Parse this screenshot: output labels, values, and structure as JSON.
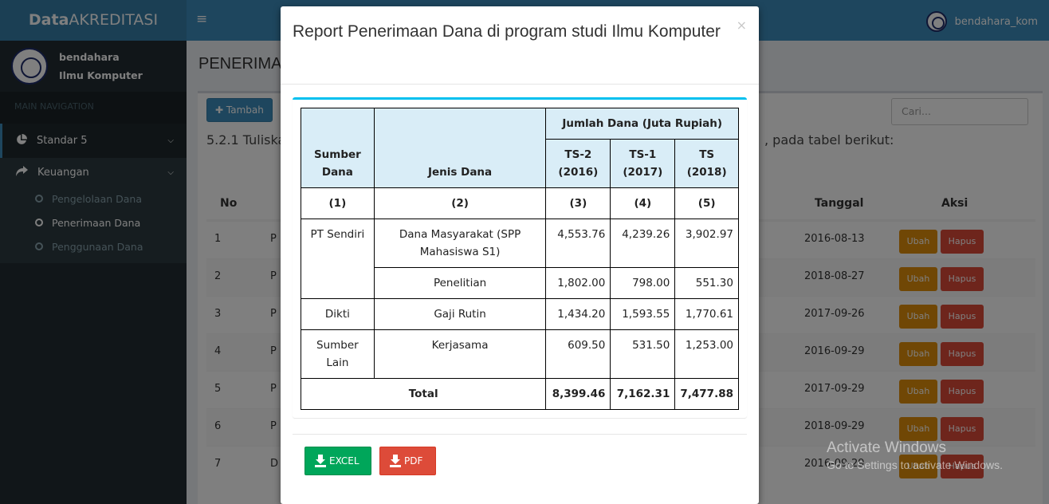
{
  "header": {
    "logo_bold": "Data",
    "logo_rest": "AKREDITASI",
    "menu_icon": "≡",
    "user": "bendahara_kom"
  },
  "sidebar": {
    "user_name": "bendahara",
    "user_unit": "Ilmu Komputer",
    "nav_header": "MAIN NAVIGATION",
    "standar": "Standar 5",
    "keuangan": "Keuangan",
    "items": [
      {
        "label": "Pengelolaan Dana"
      },
      {
        "label": "Penerimaan Dana"
      },
      {
        "label": "Penggunaan Dana"
      }
    ]
  },
  "main": {
    "page_title": "PENERIMA",
    "add_button": "Tambah",
    "search_placeholder": "Cari...",
    "description_left": "5.2.1 Tuliska",
    "description_right": ", pada tabel berikut:",
    "columns": {
      "no": "No",
      "tanggal": "Tanggal",
      "aksi": "Aksi"
    },
    "rows": [
      {
        "no": "1",
        "name": "P",
        "date": "2016-08-13"
      },
      {
        "no": "2",
        "name": "P",
        "date": "2018-08-27"
      },
      {
        "no": "3",
        "name": "P",
        "date": "2017-09-26"
      },
      {
        "no": "4",
        "name": "P",
        "date": "2016-09-29"
      },
      {
        "no": "5",
        "name": "P",
        "date": "2017-09-29"
      },
      {
        "no": "6",
        "name": "P",
        "date": "2018-09-29"
      },
      {
        "no": "7",
        "name": "D",
        "date": "2016-09-29"
      }
    ],
    "edit_label": "Ubah",
    "delete_label": "Hapus"
  },
  "modal": {
    "title": "Report Penerimaan Dana di program studi Ilmu Komputer",
    "close": "×",
    "table": {
      "h_sumber": "Sumber Dana",
      "h_jenis": "Jenis Dana",
      "h_jumlah": "Jumlah Dana (Juta Rupiah)",
      "h_ts2": "TS-2",
      "h_ts2_year": "(2016)",
      "h_ts1": "TS-1",
      "h_ts1_year": "(2017)",
      "h_ts": "TS",
      "h_ts_year": "(2018)",
      "idx": [
        "(1)",
        "(2)",
        "(3)",
        "(4)",
        "(5)"
      ],
      "rows": [
        {
          "sumber": "PT Sendiri",
          "jenis": "Dana Masyarakat (SPP Mahasiswa S1)",
          "ts2": "4,553.76",
          "ts1": "4,239.26",
          "ts": "3,902.97"
        },
        {
          "jenis": "Penelitian",
          "ts2": "1,802.00",
          "ts1": "798.00",
          "ts": "551.30"
        },
        {
          "sumber": "Dikti",
          "jenis": "Gaji Rutin",
          "ts2": "1,434.20",
          "ts1": "1,593.55",
          "ts": "1,770.61"
        },
        {
          "sumber": "Sumber Lain",
          "jenis": "Kerjasama",
          "ts2": "609.50",
          "ts1": "531.50",
          "ts": "1,253.00"
        }
      ],
      "total_label": "Total",
      "total": {
        "ts2": "8,399.46",
        "ts1": "7,162.31",
        "ts": "7,477.88"
      }
    },
    "excel_label": "EXCEL",
    "pdf_label": "PDF"
  },
  "watermark": {
    "line1": "Activate Windows",
    "line2": "Go to Settings to activate Windows."
  }
}
